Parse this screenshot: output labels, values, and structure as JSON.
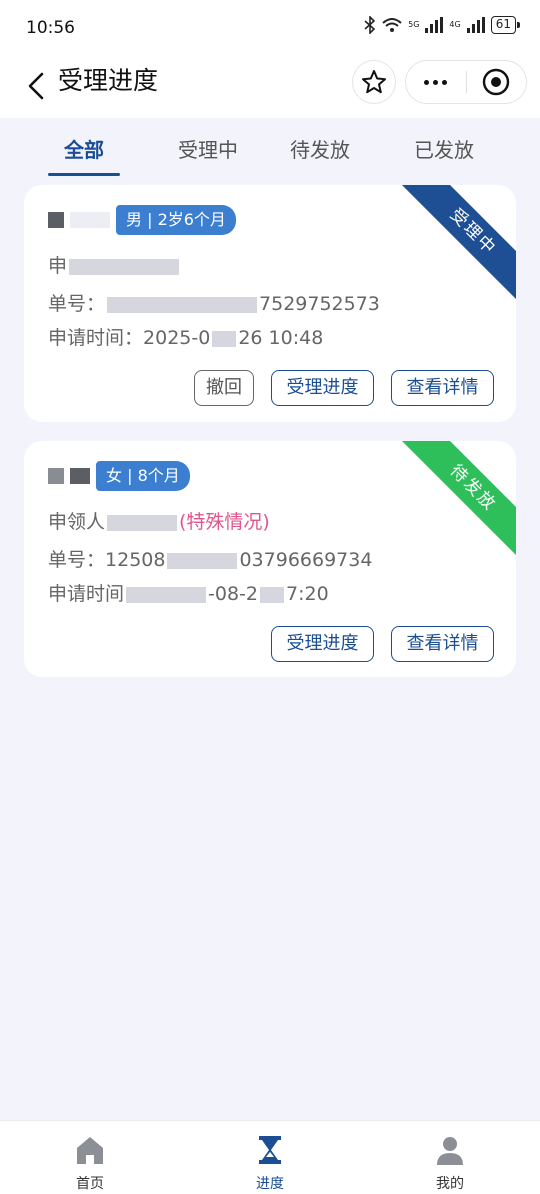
{
  "status_bar": {
    "time": "10:56",
    "net_5g": "5G",
    "net_4g": "4G",
    "battery": "61"
  },
  "nav": {
    "title": "受理进度"
  },
  "tabs": [
    {
      "label": "全部",
      "active": true
    },
    {
      "label": "受理中",
      "active": false
    },
    {
      "label": "待发放",
      "active": false
    },
    {
      "label": "已发放",
      "active": false
    }
  ],
  "cards": [
    {
      "gender_age": "男 | 2岁6个月",
      "status": "受理中",
      "applicant_prefix": "申",
      "order_prefix": "单号：",
      "order_tail": "7529752573",
      "time_prefix": "申请时间：",
      "time_start": "2025-0",
      "time_tail": "26 10:48",
      "buttons": {
        "withdraw": "撤回",
        "progress": "受理进度",
        "detail": "查看详情"
      }
    },
    {
      "gender_age": "女 | 8个月",
      "status": "待发放",
      "applicant_prefix": "申领人",
      "applicant_note": "(特殊情况)",
      "order_prefix": "单号：",
      "order_start": "12508",
      "order_tail": "03796669734",
      "time_prefix": "申请时间",
      "time_mid": "-08-2",
      "time_tail": "7:20",
      "buttons": {
        "progress": "受理进度",
        "detail": "查看详情"
      }
    }
  ],
  "bottom_nav": [
    {
      "label": "首页",
      "icon": "home-icon",
      "active": false
    },
    {
      "label": "进度",
      "icon": "hourglass-icon",
      "active": true
    },
    {
      "label": "我的",
      "icon": "user-icon",
      "active": false
    }
  ],
  "colors": {
    "primary": "#1b4e93",
    "badge": "#3c7fd1",
    "ribbon_processing": "#1e4f95",
    "ribbon_pending": "#2fbf5a",
    "special": "#e0578e"
  }
}
